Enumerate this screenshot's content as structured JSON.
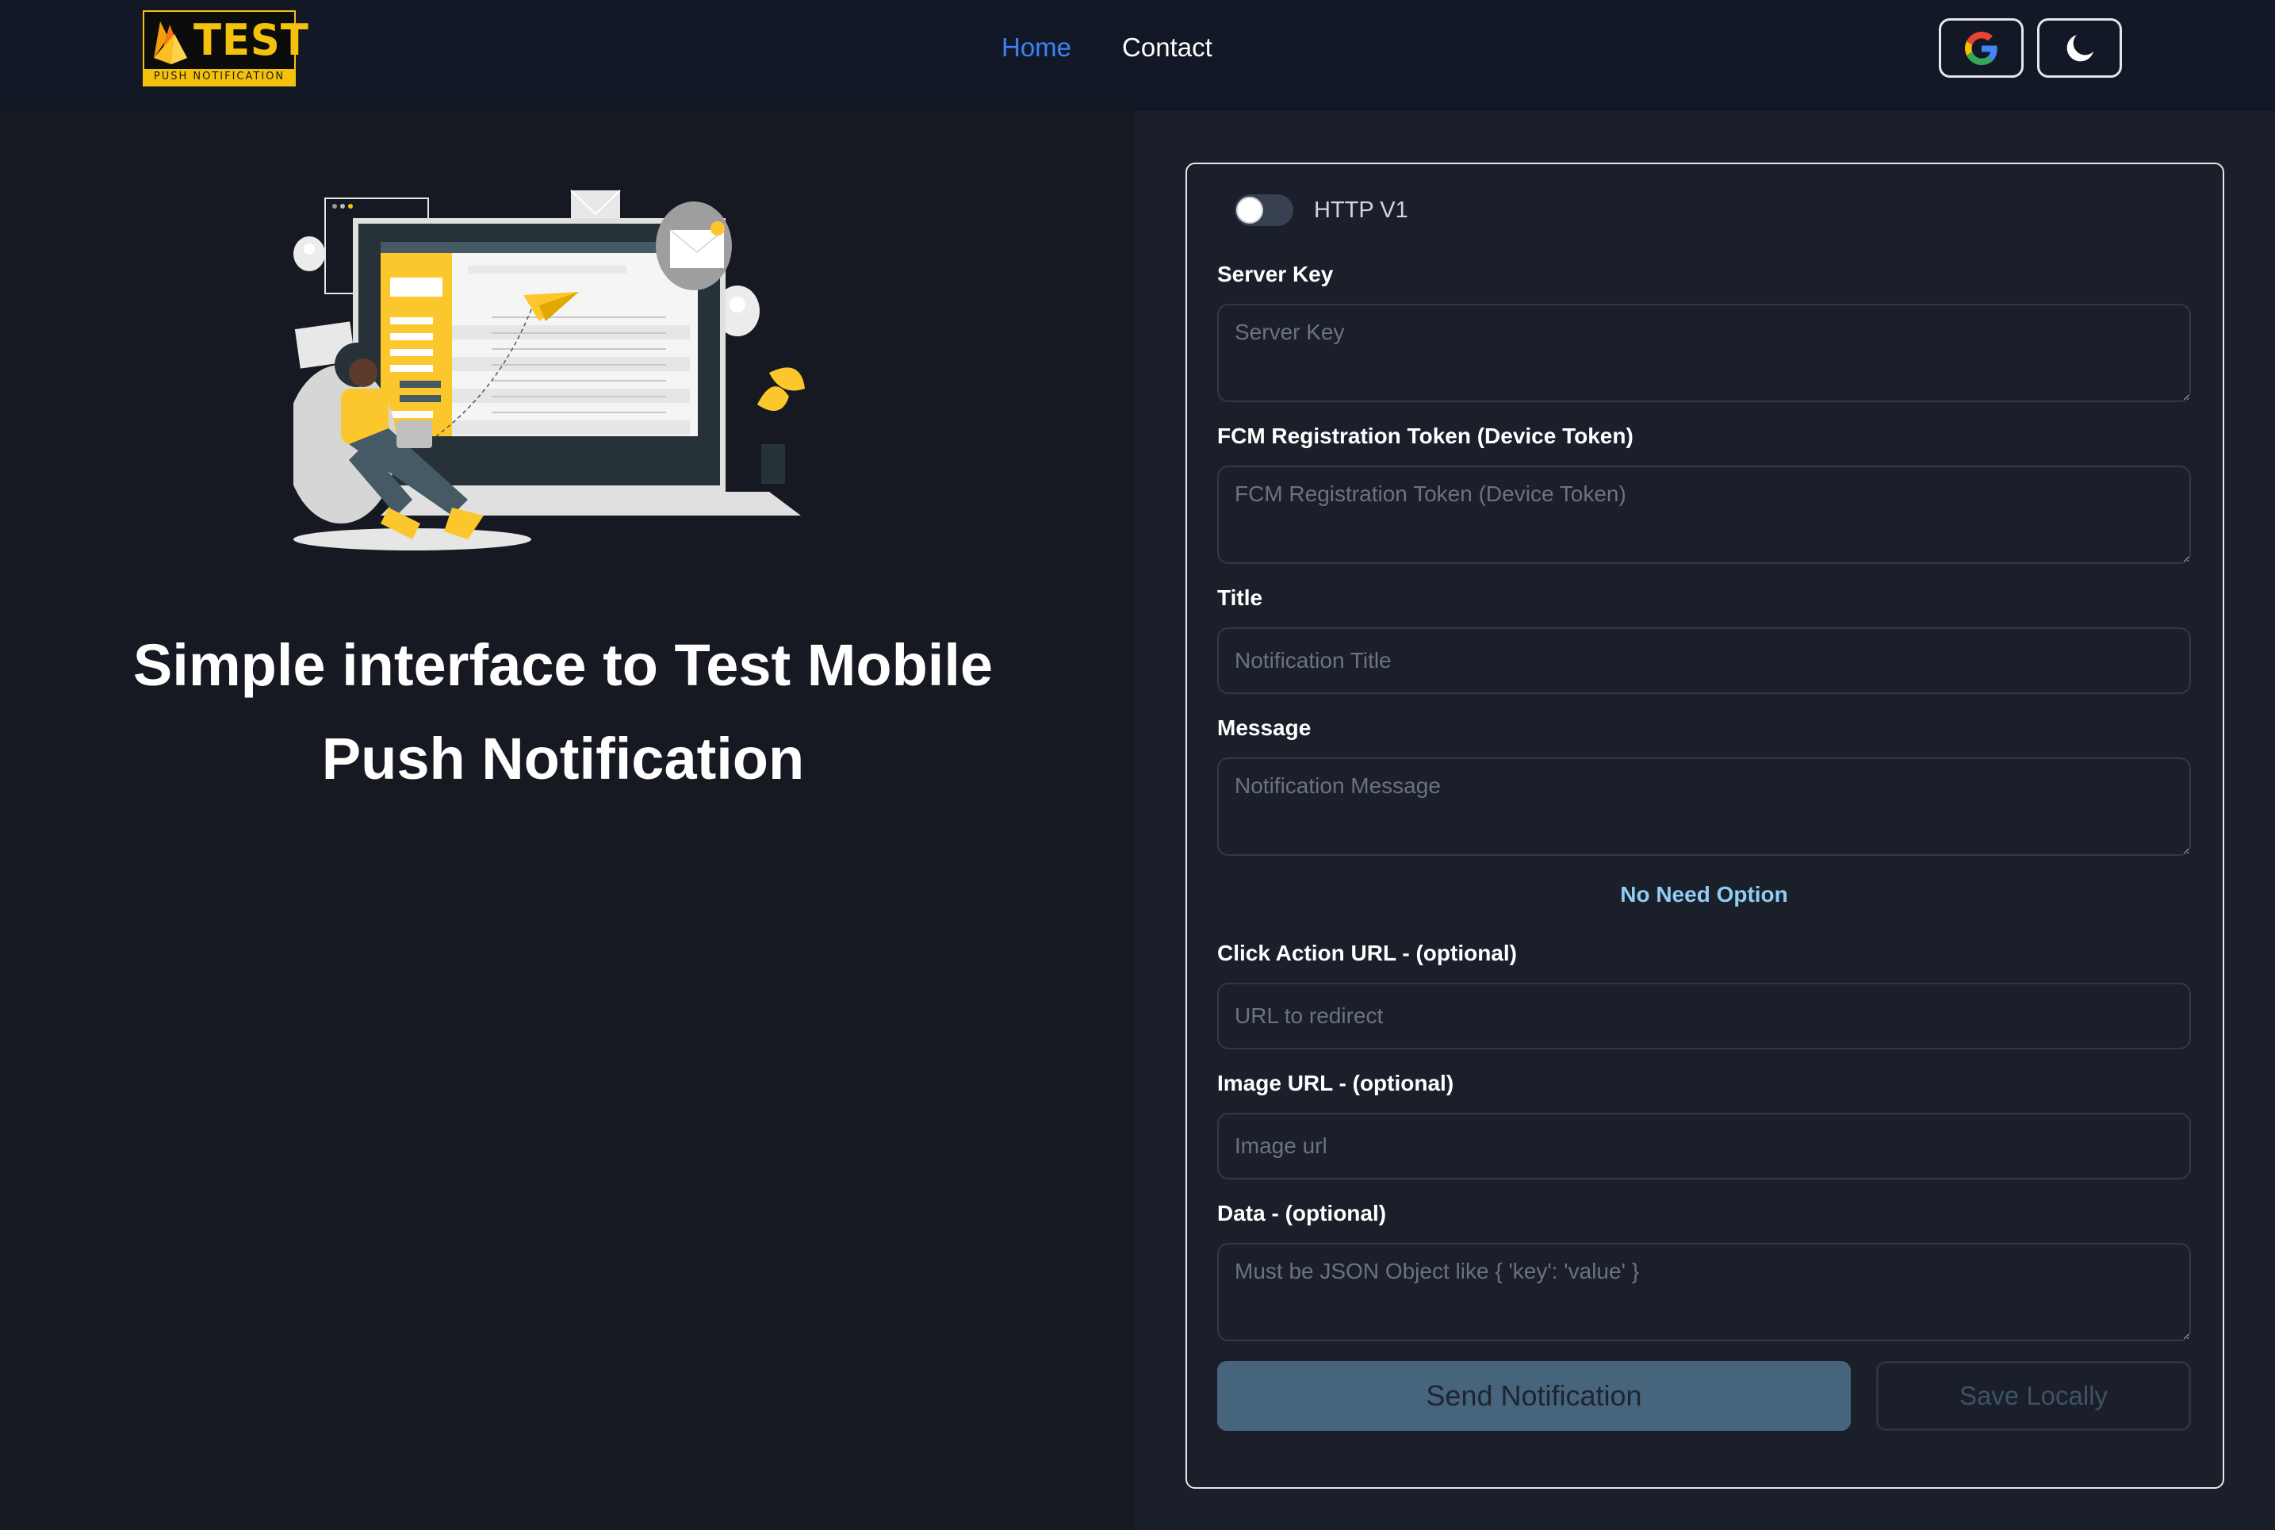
{
  "header": {
    "logo": {
      "title": "TEST",
      "subtitle": "PUSH NOTIFICATION"
    },
    "nav": [
      {
        "label": "Home",
        "active": true
      },
      {
        "label": "Contact",
        "active": false
      }
    ],
    "google_button_icon": "google-icon",
    "theme_button_icon": "moon-icon"
  },
  "hero": {
    "illustration": "person-sending-email-illustration",
    "title_line1": "Simple interface to Test Mobile",
    "title_line2": "Push Notification"
  },
  "form": {
    "toggle": {
      "label": "HTTP V1",
      "checked": false
    },
    "server_key": {
      "label": "Server Key",
      "placeholder": "Server Key",
      "value": ""
    },
    "device_token": {
      "label": "FCM Registration Token (Device Token)",
      "placeholder": "FCM Registration Token (Device Token)",
      "value": ""
    },
    "title": {
      "label": "Title",
      "placeholder": "Notification Title",
      "value": ""
    },
    "message": {
      "label": "Message",
      "placeholder": "Notification Message",
      "value": ""
    },
    "no_need_option": "No Need Option",
    "click_action": {
      "label": "Click Action URL - (optional)",
      "placeholder": "URL to redirect",
      "value": ""
    },
    "image_url": {
      "label": "Image URL - (optional)",
      "placeholder": "Image url",
      "value": ""
    },
    "data": {
      "label": "Data - (optional)",
      "placeholder": "Must be JSON Object like { 'key': 'value' }",
      "value": ""
    },
    "send_button": "Send Notification",
    "save_button": "Save Locally"
  },
  "colors": {
    "accent_blue": "#3b82f6",
    "brand_yellow": "#f4c20d",
    "link_light_blue": "#90cdf4",
    "send_button_bg": "#46647c"
  }
}
